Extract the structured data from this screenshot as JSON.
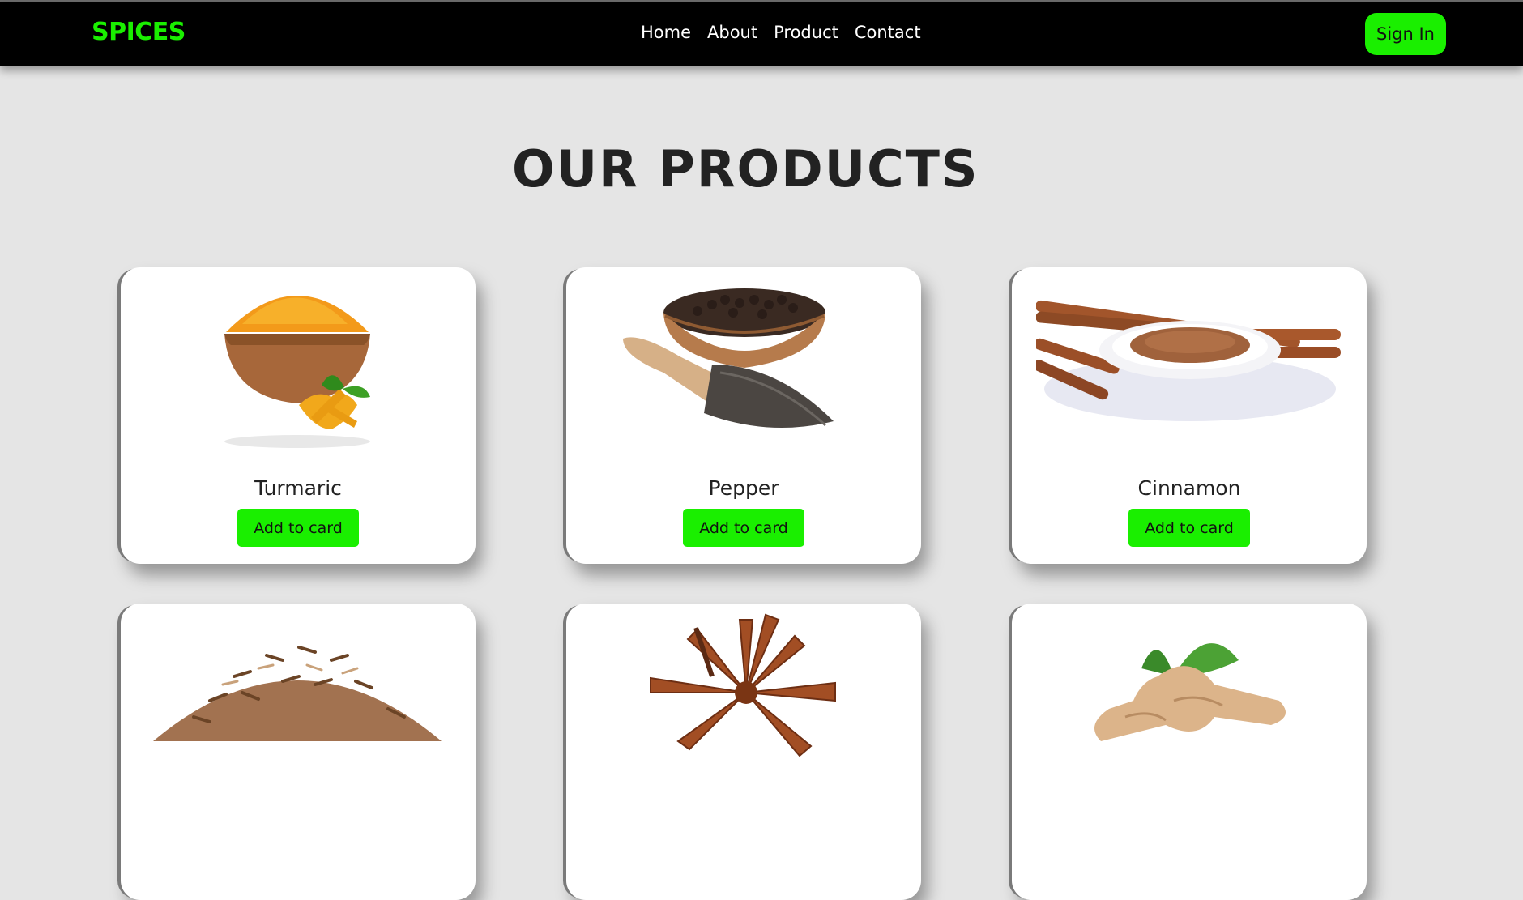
{
  "nav": {
    "brand": "SPICES",
    "links": [
      "Home",
      "About",
      "Product",
      "Contact"
    ],
    "signin_label": "Sign In"
  },
  "main": {
    "heading": "OUR PRODUCTS",
    "add_label": "Add to card",
    "products": [
      {
        "name": "Turmaric",
        "image": "turmeric-image"
      },
      {
        "name": "Pepper",
        "image": "pepper-image"
      },
      {
        "name": "Cinnamon",
        "image": "cinnamon-image"
      },
      {
        "name": "",
        "image": "cumin-image"
      },
      {
        "name": "",
        "image": "star-anise-image"
      },
      {
        "name": "",
        "image": "ginger-image"
      }
    ]
  },
  "colors": {
    "accent": "#1aef00",
    "navbar": "#000000",
    "background": "#e5e5e5"
  }
}
